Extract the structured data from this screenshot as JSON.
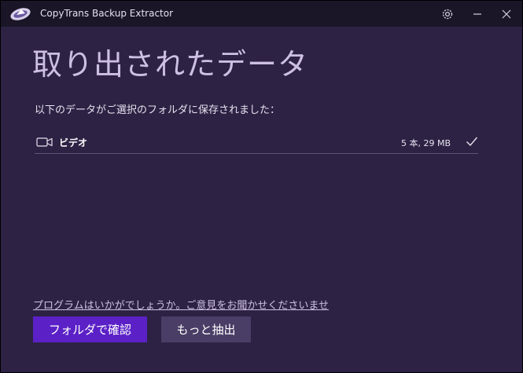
{
  "app": {
    "title": "CopyTrans Backup Extractor"
  },
  "titlebar": {
    "settings_icon": "gear-icon",
    "minimize_icon": "minimize-icon",
    "close_icon": "close-icon"
  },
  "main": {
    "title": "取り出されたデータ",
    "subtitle": "以下のデータがご選択のフォルダに保存されました：",
    "items": [
      {
        "icon": "video-camera-icon",
        "label": "ビデオ",
        "stats": "5 本, 29 MB",
        "status_icon": "check-icon"
      }
    ],
    "feedback_link": "プログラムはいかがでしょうか。ご意見をお聞かせくださいませ",
    "buttons": {
      "open_folder": "フォルダで確認",
      "extract_more": "もっと抽出"
    }
  },
  "colors": {
    "background": "#2d2244",
    "titlebar": "#1a1628",
    "title_text": "#cdbfe3",
    "primary_button": "#5b21c7",
    "secondary_button": "#4a3d66"
  }
}
